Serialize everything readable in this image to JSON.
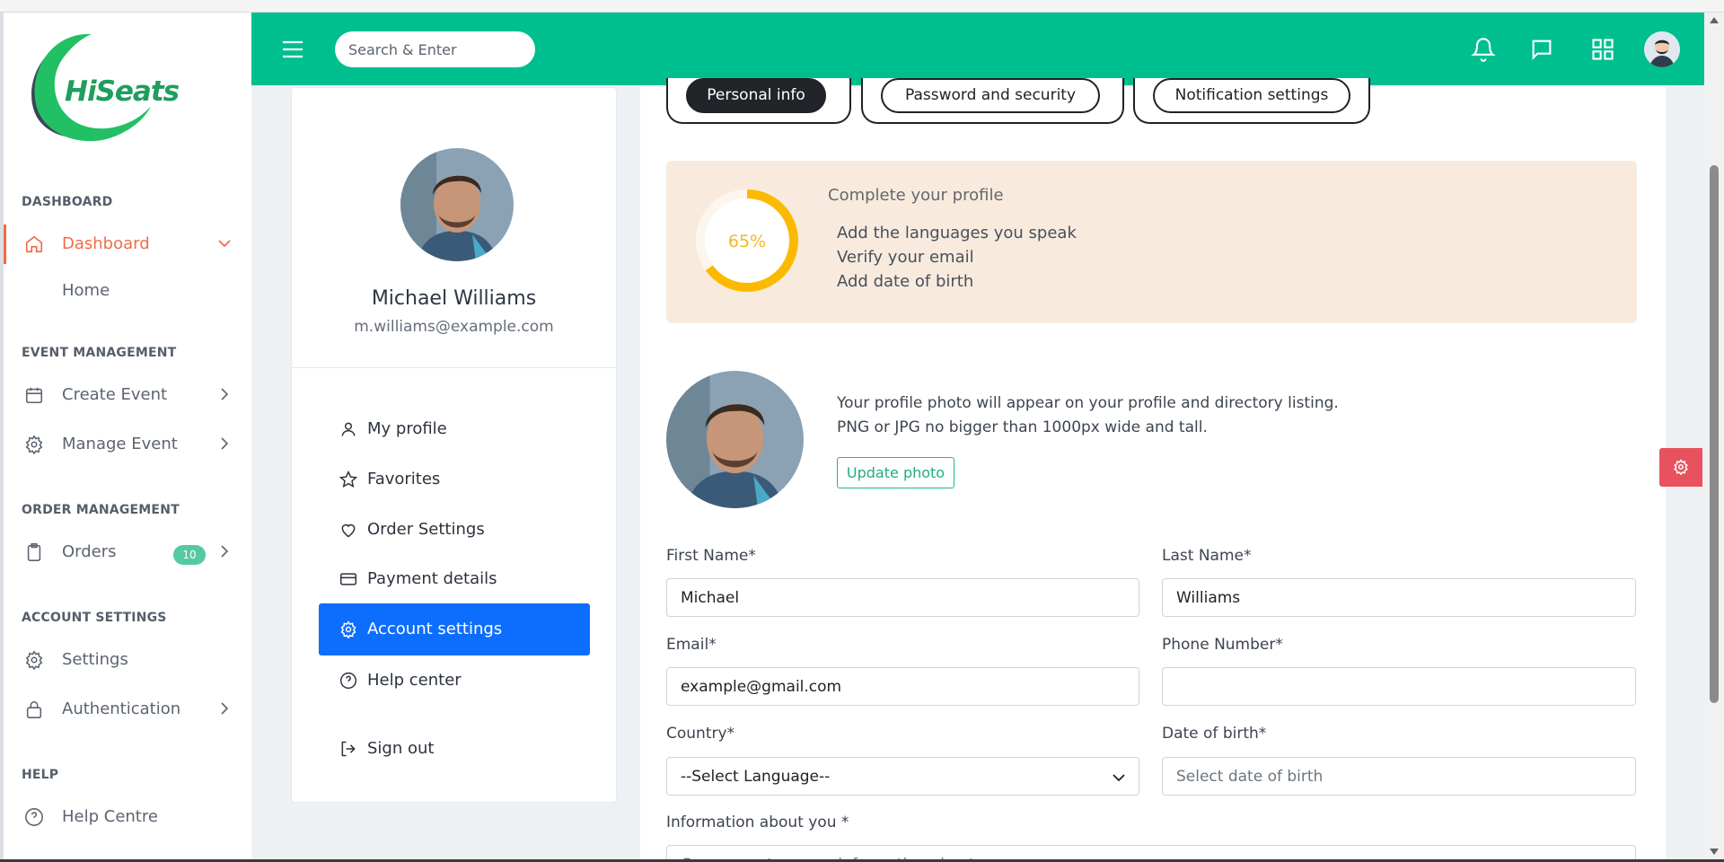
{
  "brand": {
    "name": "HiSeats",
    "accent": "#00bf8f",
    "orange": "#f26b45"
  },
  "header": {
    "search_placeholder": "Search & Enter",
    "icons": [
      "menu-icon",
      "bell-icon",
      "chat-icon",
      "apps-grid-icon",
      "user-avatar"
    ]
  },
  "sidebar": {
    "sections": {
      "dashboard": "DASHBOARD",
      "event": "EVENT MANAGEMENT",
      "order": "ORDER MANAGEMENT",
      "account": "ACCOUNT SETTINGS",
      "help": "HELP"
    },
    "items": {
      "dashboard": "Dashboard",
      "home": "Home",
      "create_event": "Create Event",
      "manage_event": "Manage Event",
      "orders": "Orders",
      "orders_badge": "10",
      "settings": "Settings",
      "authentication": "Authentication",
      "help_centre": "Help Centre"
    }
  },
  "profile": {
    "name": "Michael Williams",
    "email": "m.williams@example.com",
    "menu": {
      "my_profile": "My profile",
      "favorites": "Favorites",
      "order_settings": "Order Settings",
      "payment_details": "Payment details",
      "account_settings": "Account settings",
      "help_center": "Help center",
      "sign_out": "Sign out"
    }
  },
  "tabs": {
    "personal_info": "Personal info",
    "password_security": "Password and security",
    "notification_settings": "Notification settings"
  },
  "completion": {
    "percent_label": "65%",
    "percent_value": 65,
    "title": "Complete your profile",
    "tasks": [
      "Add the languages you speak",
      "Verify your email",
      "Add date of birth"
    ]
  },
  "photo": {
    "description": "Your profile photo will appear on your profile and directory listing. PNG or JPG no bigger than 1000px wide and tall.",
    "button": "Update photo"
  },
  "form": {
    "first_name_label": "First Name*",
    "first_name_value": "Michael",
    "last_name_label": "Last Name*",
    "last_name_value": "Williams",
    "email_label": "Email*",
    "email_value": "example@gmail.com",
    "phone_label": "Phone Number*",
    "phone_value": "",
    "country_label": "Country*",
    "country_value": "--Select Language--",
    "dob_label": "Date of birth*",
    "dob_placeholder": "Select date of birth",
    "info_label": "Information about you *",
    "info_placeholder": "Can you enter more information about you"
  }
}
